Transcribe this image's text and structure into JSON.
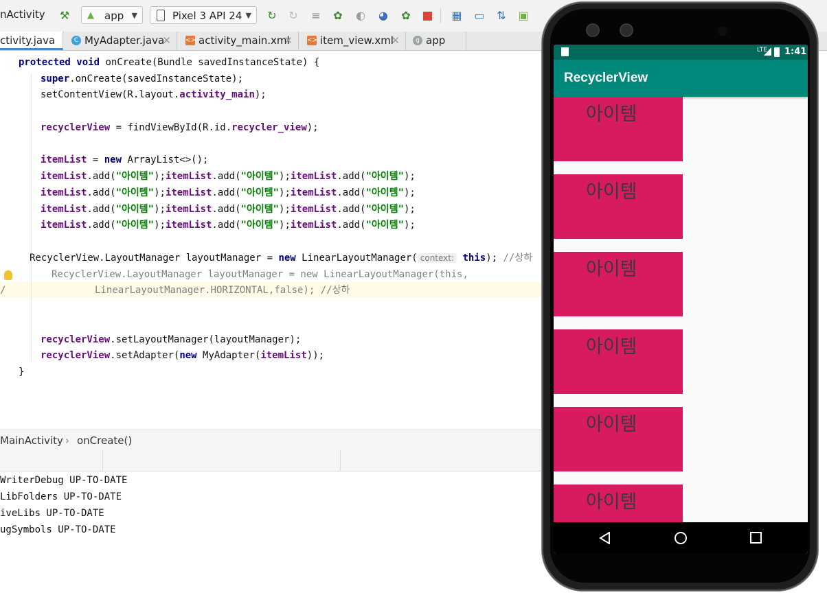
{
  "ide": {
    "run_config_label": "nActivity",
    "module_select": "app",
    "device_select": "Pixel 3 API 24",
    "tabs": [
      {
        "label": "ctivity.java",
        "active": true
      },
      {
        "label": "MyAdapter.java"
      },
      {
        "label": "activity_main.xml"
      },
      {
        "label": "item_view.xml"
      },
      {
        "label": "app"
      }
    ],
    "code": {
      "oncreate_protected": "protected",
      "oncreate_void": "void",
      "oncreate_rest": " onCreate(Bundle savedInstanceState) {",
      "super_kw": "super",
      "super_rest": ".onCreate(savedInstanceState);",
      "setcontent_a": "setContentView(R.layout.",
      "setcontent_field": "activity_main",
      "setcontent_b": ");",
      "rv_field": "recyclerView",
      "rv_mid": " = findViewById(R.id.",
      "rv_id": "recycler_view",
      "rv_end": ");",
      "list_field": "itemList",
      "list_eq": " = ",
      "list_new": "new",
      "list_rest": " ArrayList<>();",
      "add_field": "itemList",
      "add_call": ".add(",
      "add_string": "\"아이템\"",
      "add_close": ");",
      "lm_a": "RecyclerView.LayoutManager layoutManager = ",
      "lm_new": "new",
      "lm_b": " LinearLayoutManager(",
      "lm_hint": "context:",
      "lm_this": "this",
      "lm_c": "); ",
      "lm_comment": "//상하",
      "c1": "RecyclerView.LayoutManager layoutManager = new LinearLayoutManager(this,",
      "c2_slash": "/",
      "c2": "LinearLayoutManager.HORIZONTAL,false); //상하",
      "setlm_field": "recyclerView",
      "setlm_rest": ".setLayoutManager(layoutManager);",
      "setad_field": "recyclerView",
      "setad_mid": ".setAdapter(",
      "setad_new": "new",
      "setad_b": " MyAdapter(",
      "setad_list": "itemList",
      "setad_end": "));",
      "close_brace": "}"
    },
    "breadcrumbs": [
      "MainActivity",
      "onCreate()"
    ],
    "breadcrumb_sep": "›",
    "build_output": [
      "WriterDebug UP-TO-DATE",
      "LibFolders UP-TO-DATE",
      "iveLibs UP-TO-DATE",
      "ugSymbols UP-TO-DATE"
    ]
  },
  "emulator": {
    "status_time": "1:41",
    "status_network": "LTE",
    "app_title": "RecyclerView",
    "items": [
      "아이템",
      "아이템",
      "아이템",
      "아이템",
      "아이템",
      "아이템"
    ],
    "item_color": "#d81b60",
    "appbar_color": "#00897b",
    "statusbar_color": "#00695c"
  },
  "icons": [
    "hammer-icon",
    "android-icon",
    "device-icon",
    "run-icon",
    "debug-icon",
    "profiler-icon",
    "stop-icon",
    "back-icon",
    "home-icon",
    "recents-icon"
  ]
}
